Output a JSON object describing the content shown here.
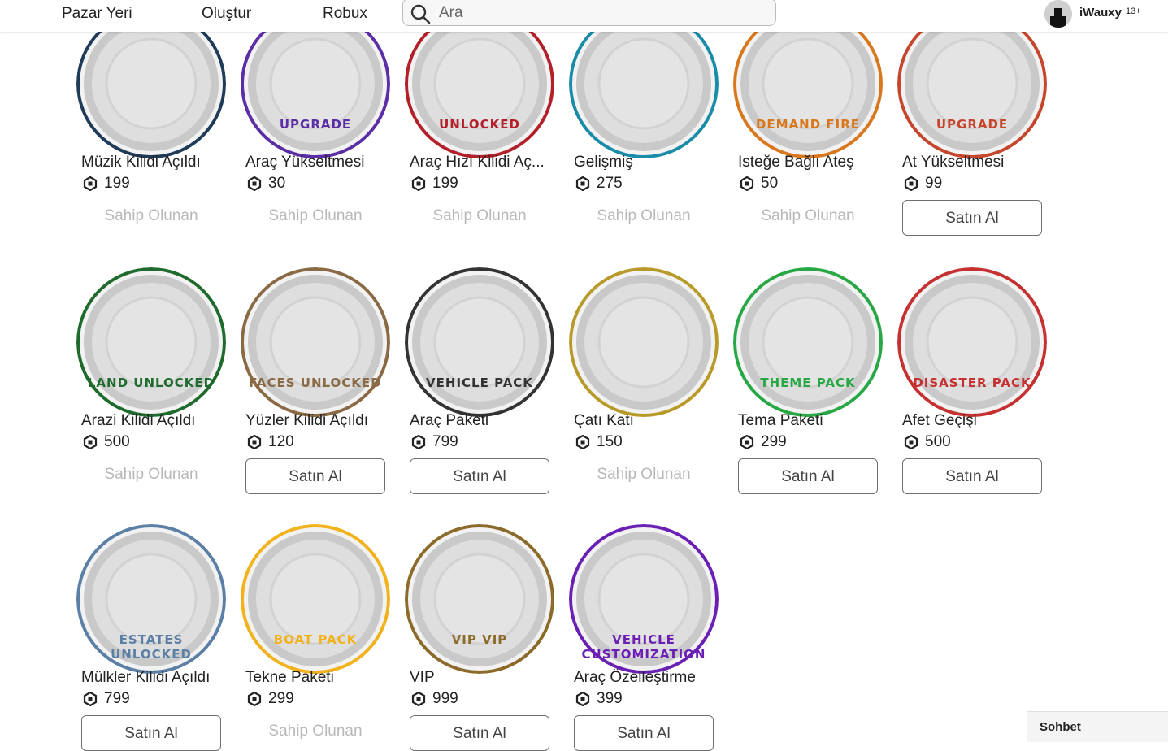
{
  "topbar": {
    "nav": [
      "Pazar Yeri",
      "Oluştur",
      "Robux"
    ],
    "search_placeholder": "Ara",
    "username": "iWauxy",
    "age_badge": "13+"
  },
  "labels": {
    "owned": "Sahip Olunan",
    "buy": "Satın Al"
  },
  "items": [
    {
      "name": "Müzik Kilidi Açıldı",
      "price": "199",
      "owned": true,
      "badge_text": "",
      "ring_color": "#1f3b57",
      "icon": "speaker-icon"
    },
    {
      "name": "Araç Yükseltmesi",
      "price": "30",
      "owned": true,
      "badge_text": "UPGRADE",
      "ring_color": "#5b2ea6",
      "icon": "car-upgrade-icon"
    },
    {
      "name": "Araç Hızı Kilidi Aç...",
      "price": "199",
      "owned": true,
      "badge_text": "UNLOCKED",
      "ring_color": "#b3202a",
      "icon": "speedometer-icon"
    },
    {
      "name": "Gelişmiş",
      "price": "275",
      "owned": true,
      "badge_text": "",
      "ring_color": "#1a8ca8",
      "icon": "star-icon"
    },
    {
      "name": "İsteğe Bağlı Ateş",
      "price": "50",
      "owned": true,
      "badge_text": "DEMAND FIRE",
      "ring_color": "#d9771c",
      "icon": "house-fire-icon"
    },
    {
      "name": "At Yükseltmesi",
      "price": "99",
      "owned": false,
      "badge_text": "UPGRADE",
      "ring_color": "#c5462c",
      "icon": "horse-icon"
    },
    {
      "name": "Arazi Kilidi Açıldı",
      "price": "500",
      "owned": true,
      "badge_text": "LAND UNLOCKED",
      "ring_color": "#1f6b2e",
      "icon": "land-icon"
    },
    {
      "name": "Yüzler Kilidi Açıldı",
      "price": "120",
      "owned": false,
      "badge_text": "FACES UNLOCKED",
      "ring_color": "#8a6a45",
      "icon": "face-icon"
    },
    {
      "name": "Araç Paketi",
      "price": "799",
      "owned": false,
      "badge_text": "VEHICLE PACK",
      "ring_color": "#333333",
      "icon": "vehicles-icon"
    },
    {
      "name": "Çatı Katı",
      "price": "150",
      "owned": true,
      "badge_text": "",
      "ring_color": "#b89a2a",
      "icon": "diamond-icon"
    },
    {
      "name": "Tema Paketi",
      "price": "299",
      "owned": false,
      "badge_text": "THEME PACK",
      "ring_color": "#28a745",
      "icon": "paintbrush-icon"
    },
    {
      "name": "Afet Geçişi",
      "price": "500",
      "owned": false,
      "badge_text": "DISASTER PACK",
      "ring_color": "#c53030",
      "icon": "broken-house-icon"
    },
    {
      "name": "Mülkler Kilidi Açıldı",
      "price": "799",
      "owned": false,
      "badge_text": "ESTATES UNLOCKED",
      "ring_color": "#5c7fa6",
      "icon": "mansion-icon"
    },
    {
      "name": "Tekne Paketi",
      "price": "299",
      "owned": true,
      "badge_text": "BOAT PACK",
      "ring_color": "#f2b21b",
      "icon": "boat-icon"
    },
    {
      "name": "VIP",
      "price": "999",
      "owned": false,
      "badge_text": "VIP VIP",
      "ring_color": "#8c6a2a",
      "icon": "crown-icon"
    },
    {
      "name": "Araç Özelleştirme",
      "price": "399",
      "owned": false,
      "badge_text": "VEHICLE CUSTOMIZATION",
      "ring_color": "#6a1fb5",
      "icon": "spray-can-icon"
    }
  ],
  "chat": {
    "label": "Sohbet"
  }
}
